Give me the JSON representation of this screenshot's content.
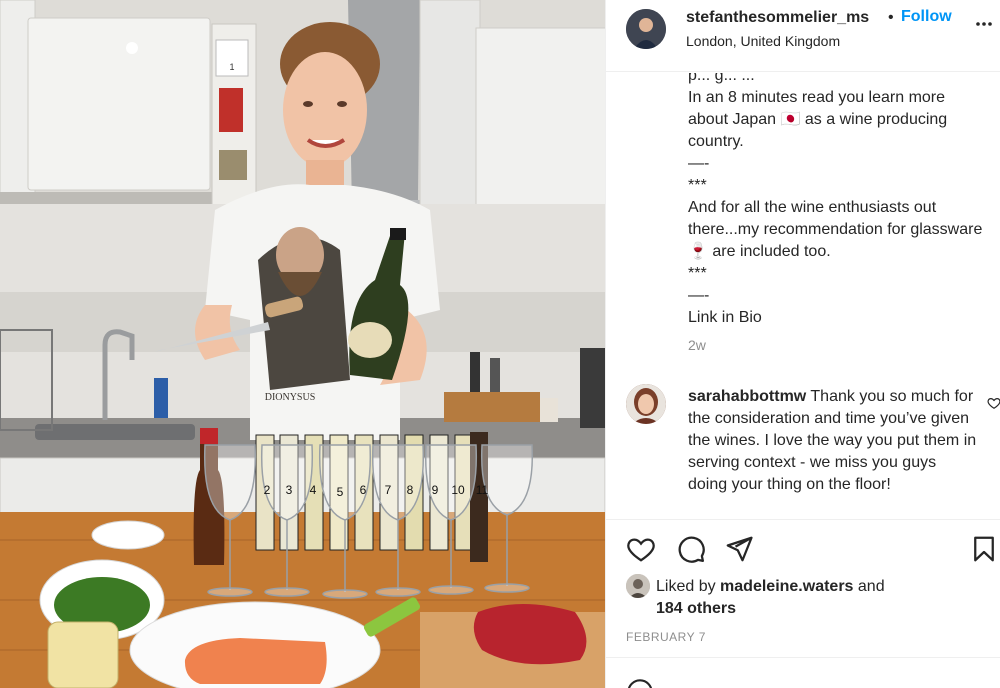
{
  "post": {
    "username": "stefanthesommelier_ms",
    "separator": "•",
    "follow_label": "Follow",
    "location": "London, United Kingdom"
  },
  "caption": {
    "lines": [
      "p... g... ...",
      "In an 8 minutes read you learn more about Japan 🇯🇵 as a wine producing country.",
      "—-",
      "***",
      "And for all the wine enthusiasts out there...my recommendation for glassware 🍷 are included too.",
      "***",
      "—-",
      "Link in Bio"
    ],
    "time_ago": "2w"
  },
  "comment": {
    "username": "sarahabbottmw",
    "text": " Thank you so much for the consideration and time you’ve given the wines. I love the way you put them in serving context - we miss you guys doing your thing on the floor!"
  },
  "likes": {
    "prefix": "Liked by ",
    "user": "madeleine.waters",
    "suffix": " and",
    "others": "184 others"
  },
  "date": "FEBRUARY 7",
  "photo": {
    "shirt_text": "DIONYSUS",
    "glass_numbers": [
      "2",
      "3",
      "4",
      "5",
      "6",
      "7",
      "8",
      "9",
      "10",
      "11"
    ],
    "calendar_day": "1"
  },
  "icons": {
    "more": "more-options-icon",
    "like": "heart-icon",
    "comment": "comment-bubble-icon",
    "share": "paper-plane-icon",
    "save": "bookmark-icon"
  },
  "colors": {
    "accent": "#0095f6",
    "text": "#262626",
    "muted": "#8e8e8e",
    "divider": "#efefef"
  }
}
